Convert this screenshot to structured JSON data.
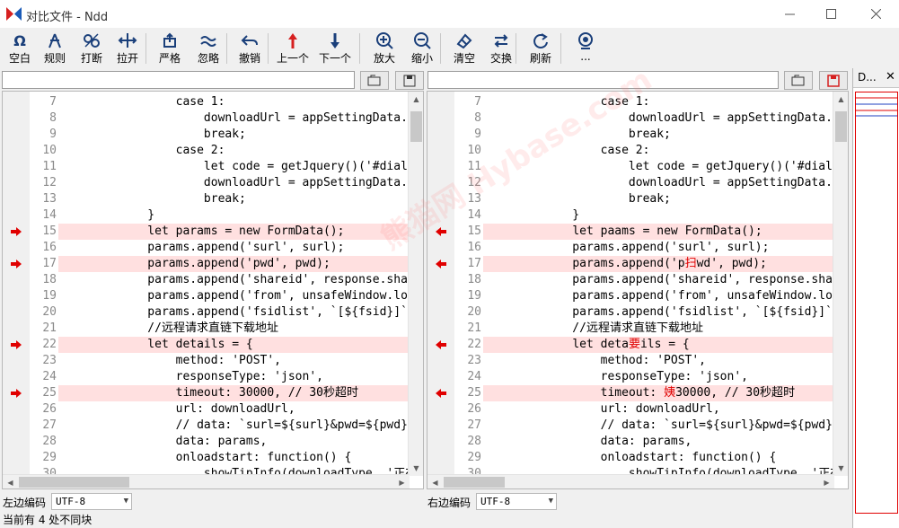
{
  "window": {
    "title": "对比文件 - Ndd",
    "brand_color": "#d62020",
    "accent": "#1a5bb8"
  },
  "toolbar": [
    {
      "name": "blank-button",
      "label": "空白",
      "icon": "omega-icon"
    },
    {
      "name": "rules-button",
      "label": "规则",
      "icon": "compass-icon"
    },
    {
      "name": "break-button",
      "label": "打断",
      "icon": "break-link-icon"
    },
    {
      "name": "stretch-button",
      "label": "拉开",
      "icon": "stretch-icon"
    },
    {
      "name": "strict-button",
      "label": "严格",
      "icon": "strict-icon"
    },
    {
      "name": "ignore-button",
      "label": "忽略",
      "icon": "approx-icon"
    },
    {
      "name": "undo-button",
      "label": "撤销",
      "icon": "undo-icon"
    },
    {
      "name": "prev-diff-button",
      "label": "上一个",
      "icon": "arrow-up-icon"
    },
    {
      "name": "next-diff-button",
      "label": "下一个",
      "icon": "arrow-down-icon"
    },
    {
      "name": "zoom-in-button",
      "label": "放大",
      "icon": "zoom-in-icon"
    },
    {
      "name": "zoom-out-button",
      "label": "缩小",
      "icon": "zoom-out-icon"
    },
    {
      "name": "clear-button",
      "label": "清空",
      "icon": "eraser-icon"
    },
    {
      "name": "swap-button",
      "label": "交换",
      "icon": "swap-icon"
    },
    {
      "name": "refresh-button",
      "label": "刷新",
      "icon": "refresh-icon"
    },
    {
      "name": "more-button",
      "label": "...",
      "icon": "webcam-icon"
    }
  ],
  "left": {
    "path": "",
    "encoding_label": "左边编码",
    "encoding": "UTF-8",
    "lines": [
      {
        "n": "7",
        "code": "        case 1:",
        "diff": false
      },
      {
        "n": "8",
        "code": "            downloadUrl = appSettingData.",
        "diff": false
      },
      {
        "n": "9",
        "code": "            break;",
        "diff": false
      },
      {
        "n": "10",
        "code": "        case 2:",
        "diff": false
      },
      {
        "n": "11",
        "code": "            let code = getJquery()('#dial",
        "diff": false
      },
      {
        "n": "12",
        "code": "            downloadUrl = appSettingData.",
        "diff": false
      },
      {
        "n": "13",
        "code": "            break;",
        "diff": false
      },
      {
        "n": "14",
        "code": "    }",
        "diff": false
      },
      {
        "n": "15",
        "code": "    let params = new FormData();",
        "diff": true
      },
      {
        "n": "16",
        "code": "    params.append('surl', surl);",
        "diff": false
      },
      {
        "n": "17",
        "code": "    params.append('pwd', pwd);",
        "diff": true
      },
      {
        "n": "18",
        "code": "    params.append('shareid', response.sha",
        "diff": false
      },
      {
        "n": "19",
        "code": "    params.append('from', unsafeWindow.lo",
        "diff": false
      },
      {
        "n": "20",
        "code": "    params.append('fsidlist', `[${fsid}]`",
        "diff": false
      },
      {
        "n": "21",
        "code": "    //远程请求直链下载地址",
        "diff": false
      },
      {
        "n": "22",
        "code": "    let details = {",
        "diff": true
      },
      {
        "n": "23",
        "code": "        method: 'POST',",
        "diff": false
      },
      {
        "n": "24",
        "code": "        responseType: 'json',",
        "diff": false
      },
      {
        "n": "25",
        "code": "        timeout: 30000, // 30秒超时",
        "diff": true
      },
      {
        "n": "26",
        "code": "        url: downloadUrl,",
        "diff": false
      },
      {
        "n": "27",
        "code": "        // data: `surl=${surl}&pwd=${pwd}",
        "diff": false
      },
      {
        "n": "28",
        "code": "        data: params,",
        "diff": false
      },
      {
        "n": "29",
        "code": "        onloadstart: function() {",
        "diff": false
      },
      {
        "n": "30",
        "code": "            showTipInfo(downloadType, '正在",
        "diff": false
      }
    ]
  },
  "right": {
    "path": "",
    "encoding_label": "右边编码",
    "encoding": "UTF-8",
    "lines": [
      {
        "n": "7",
        "code": "        case 1:",
        "diff": false
      },
      {
        "n": "8",
        "code": "            downloadUrl = appSettingData.",
        "diff": false
      },
      {
        "n": "9",
        "code": "            break;",
        "diff": false
      },
      {
        "n": "10",
        "code": "        case 2:",
        "diff": false
      },
      {
        "n": "11",
        "code": "            let code = getJquery()('#dial",
        "diff": false
      },
      {
        "n": "12",
        "code": "            downloadUrl = appSettingData.",
        "diff": false
      },
      {
        "n": "13",
        "code": "            break;",
        "diff": false
      },
      {
        "n": "14",
        "code": "    }",
        "diff": false
      },
      {
        "n": "15",
        "code": "    let paams = new FormData();",
        "diff": true
      },
      {
        "n": "16",
        "code": "    params.append('surl', surl);",
        "diff": false
      },
      {
        "n": "17",
        "code": "    params.append('p扫wd', pwd);",
        "diff": true
      },
      {
        "n": "18",
        "code": "    params.append('shareid', response.sha",
        "diff": false
      },
      {
        "n": "19",
        "code": "    params.append('from', unsafeWindow.lo",
        "diff": false
      },
      {
        "n": "20",
        "code": "    params.append('fsidlist', `[${fsid}]`",
        "diff": false
      },
      {
        "n": "21",
        "code": "    //远程请求直链下载地址",
        "diff": false
      },
      {
        "n": "22",
        "code": "    let deta要ils = {",
        "diff": true
      },
      {
        "n": "23",
        "code": "        method: 'POST',",
        "diff": false
      },
      {
        "n": "24",
        "code": "        responseType: 'json',",
        "diff": false
      },
      {
        "n": "25",
        "code": "        timeout: 姨30000, // 30秒超时",
        "diff": true
      },
      {
        "n": "26",
        "code": "        url: downloadUrl,",
        "diff": false
      },
      {
        "n": "27",
        "code": "        // data: `surl=${surl}&pwd=${pwd}",
        "diff": false
      },
      {
        "n": "28",
        "code": "        data: params,",
        "diff": false
      },
      {
        "n": "29",
        "code": "        onloadstart: function() {",
        "diff": false
      },
      {
        "n": "30",
        "code": "            showTipInfo(downloadType, '正在",
        "diff": false
      }
    ]
  },
  "side_panel": {
    "title": "D...",
    "close": "✕"
  },
  "status": "当前有 4 处不同块",
  "watermark": "熊猫网 Hybase.com",
  "diff_colors": {
    "line_bg": "#ffe0e0",
    "marker": "#e00000",
    "char": "#e00000"
  }
}
